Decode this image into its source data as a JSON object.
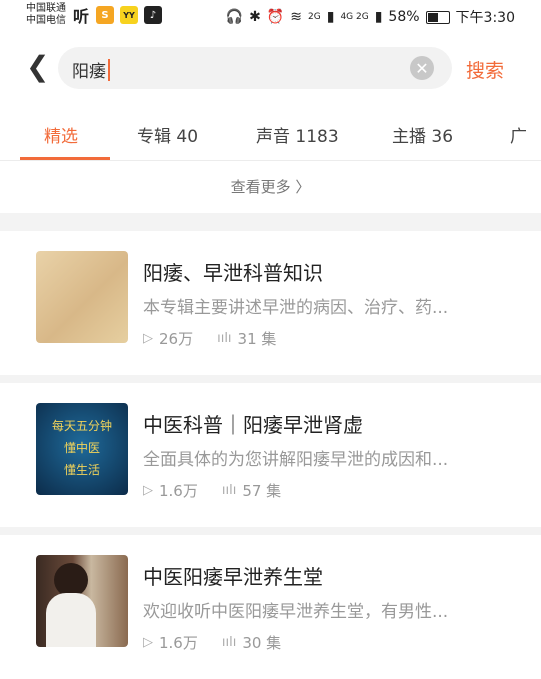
{
  "status_bar": {
    "carrier1": "中国联通",
    "carrier2": "中国电信",
    "apps": [
      "听",
      "S",
      "YY",
      "♪"
    ],
    "net1": "2G",
    "net2": "4G 2G",
    "battery": "58%",
    "battery_level": 0.58,
    "time": "下午3:30"
  },
  "search": {
    "query": "阳痿",
    "button": "搜索"
  },
  "tabs": [
    {
      "label": "精选"
    },
    {
      "label": "专辑 40"
    },
    {
      "label": "声音 1183"
    },
    {
      "label": "主播 36"
    },
    {
      "label": "广"
    }
  ],
  "see_more": "查看更多 〉",
  "results": [
    {
      "title": "阳痿、早泄科普知识",
      "desc": "本专辑主要讲述早泄的病因、治疗、药...",
      "plays": "26万",
      "episodes": "31 集",
      "cover_lines": []
    },
    {
      "title": "中医科普｜阳痿早泄肾虚",
      "desc": "全面具体的为您讲解阳痿早泄的成因和...",
      "plays": "1.6万",
      "episodes": "57 集",
      "cover_lines": [
        "每天五分钟",
        "懂中医",
        "懂生活"
      ]
    },
    {
      "title": "中医阳痿早泄养生堂",
      "desc": "欢迎收听中医阳痿早泄养生堂，有男性...",
      "plays": "1.6万",
      "episodes": "30 集",
      "cover_lines": []
    }
  ],
  "colors": {
    "accent": "#f26b3a",
    "divider": "#f3f3f3"
  }
}
